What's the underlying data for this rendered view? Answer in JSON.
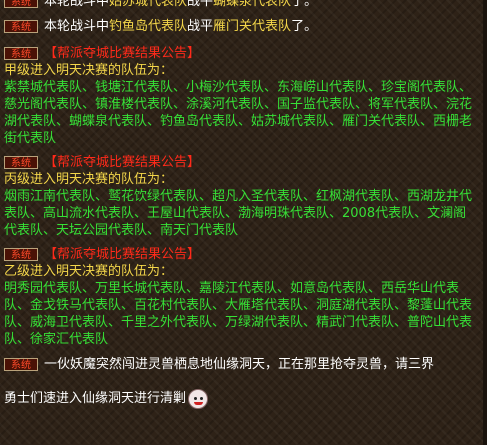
{
  "tag_label": "系统",
  "messages": [
    {
      "pre": "本轮战斗中",
      "team1": "姑苏城代表队",
      "mid": "战平",
      "team2": "蝴蝶泉代表队",
      "post": "了。"
    },
    {
      "pre": "本轮战斗中",
      "team1": "钓鱼岛代表队",
      "mid": "战平",
      "team2": "雁门关代表队",
      "post": "了。"
    }
  ],
  "announcements": [
    {
      "header": "【帮派夺城比赛结果公告】",
      "line1": "甲级进入明天决赛的队伍为：",
      "teams": "紫禁城代表队、钱塘江代表队、小梅沙代表队、东海崂山代表队、珍宝阁代表队、慈光阁代表队、镇淮楼代表队、涂溪河代表队、国子监代表队、将军代表队、浣花湖代表队、蝴蝶泉代表队、钓鱼岛代表队、姑苏城代表队、雁门关代表队、西栅老街代表队"
    },
    {
      "header": "【帮派夺城比赛结果公告】",
      "line1": "丙级进入明天决赛的队伍为：",
      "teams": "烟雨江南代表队、鹫花饮绿代表队、超凡入圣代表队、红枫湖代表队、西湖龙井代表队、高山流水代表队、王屋山代表队、渤海明珠代表队、2008代表队、文澜阁代表队、天坛公园代表队、南天门代表队"
    },
    {
      "header": "【帮派夺城比赛结果公告】",
      "line1": "乙级进入明天决赛的队伍为：",
      "teams": "明秀园代表队、万里长城代表队、嘉陵江代表队、如意岛代表队、西岳华山代表队、金戈铁马代表队、百花村代表队、大雁塔代表队、洞庭湖代表队、黎蓬山代表队、威海卫代表队、千里之外代表队、万绿湖代表队、精武门代表队、普陀山代表队、徐家汇代表队"
    }
  ],
  "final_message": {
    "line1": "一伙妖魔突然闯进灵兽栖息地仙缘洞天，正在那里抢夺灵兽，请三界",
    "line2": "勇士们速进入仙缘洞天进行清剿"
  },
  "colors": {
    "yellow": "#f3d64a",
    "green": "#36e036",
    "red": "#ff2a1a",
    "white": "#ffffff"
  }
}
